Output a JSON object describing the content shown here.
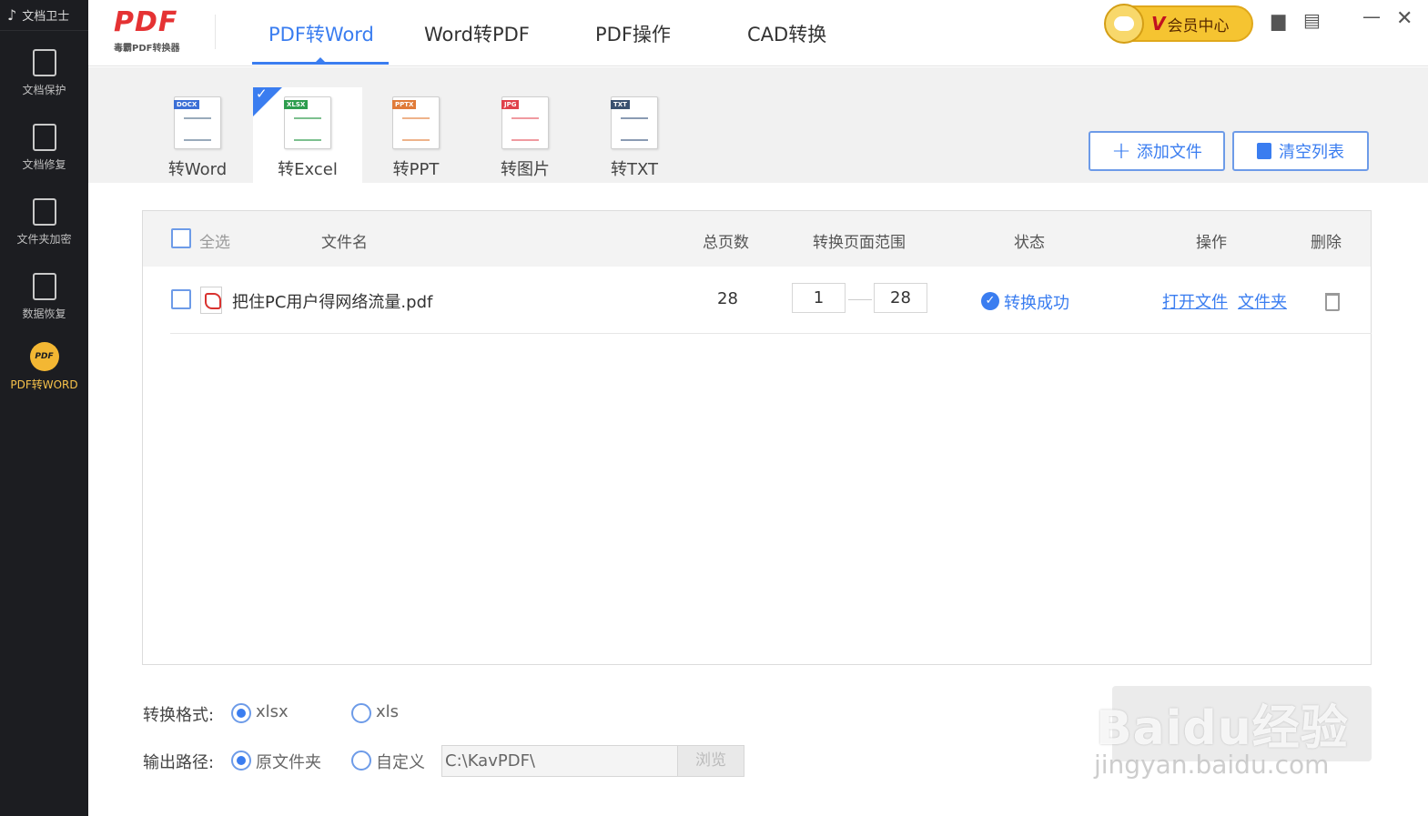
{
  "sidebar": {
    "title": "文档卫士",
    "items": [
      {
        "label": "文档保护",
        "icon": "shield-icon"
      },
      {
        "label": "文档修复",
        "icon": "document-repair-icon"
      },
      {
        "label": "文件夹加密",
        "icon": "folder-lock-icon"
      },
      {
        "label": "数据恢复",
        "icon": "data-recovery-icon"
      },
      {
        "label": "PDF转WORD",
        "icon": "pdf-convert-icon",
        "badge": "PDF"
      }
    ]
  },
  "brand": {
    "logo": "PDF",
    "subtitle": "毒霸PDF转换器"
  },
  "nav": {
    "tabs": [
      "PDF转Word",
      "Word转PDF",
      "PDF操作",
      "CAD转换"
    ],
    "active": 0
  },
  "topbar": {
    "vip_v": "V",
    "vip_label": "会员中心",
    "icons": [
      "feedback-icon",
      "message-icon",
      "minimize-icon",
      "close-icon"
    ]
  },
  "converters": {
    "items": [
      {
        "label": "转Word",
        "tag": "DOCX",
        "color": "#3b6fd6"
      },
      {
        "label": "转Excel",
        "tag": "XLSX",
        "color": "#2e9d4e"
      },
      {
        "label": "转PPT",
        "tag": "PPTX",
        "color": "#e07b39"
      },
      {
        "label": "转图片",
        "tag": "JPG",
        "color": "#e0414b"
      },
      {
        "label": "转TXT",
        "tag": "TXT",
        "color": "#3a5170"
      }
    ],
    "active": 1
  },
  "actions": {
    "add_file": "添加文件",
    "clear_list": "清空列表"
  },
  "table": {
    "headers": {
      "select_all": "全选",
      "filename": "文件名",
      "pages": "总页数",
      "range": "转换页面范围",
      "status": "状态",
      "operation": "操作",
      "delete": "删除"
    },
    "rows": [
      {
        "filename": "把住PC用户得网络流量.pdf",
        "pages": "28",
        "range_from": "1",
        "range_to": "28",
        "status": "转换成功",
        "op_open": "打开文件",
        "op_folder": "文件夹"
      }
    ]
  },
  "bottom": {
    "format_label": "转换格式:",
    "format_options": [
      "xlsx",
      "xls"
    ],
    "format_selected": "xlsx",
    "output_label": "输出路径:",
    "output_options": [
      "原文件夹",
      "自定义"
    ],
    "output_selected": "原文件夹",
    "path": "C:\\KavPDF\\",
    "browse": "浏览"
  },
  "watermark": {
    "text": "Baidu经验",
    "url": "jingyan.baidu.com"
  },
  "colors": {
    "accent": "#3a7df0",
    "sidebar_bg": "#1c1d21",
    "brand_red": "#e53233",
    "vip_gold": "#f5c431"
  }
}
